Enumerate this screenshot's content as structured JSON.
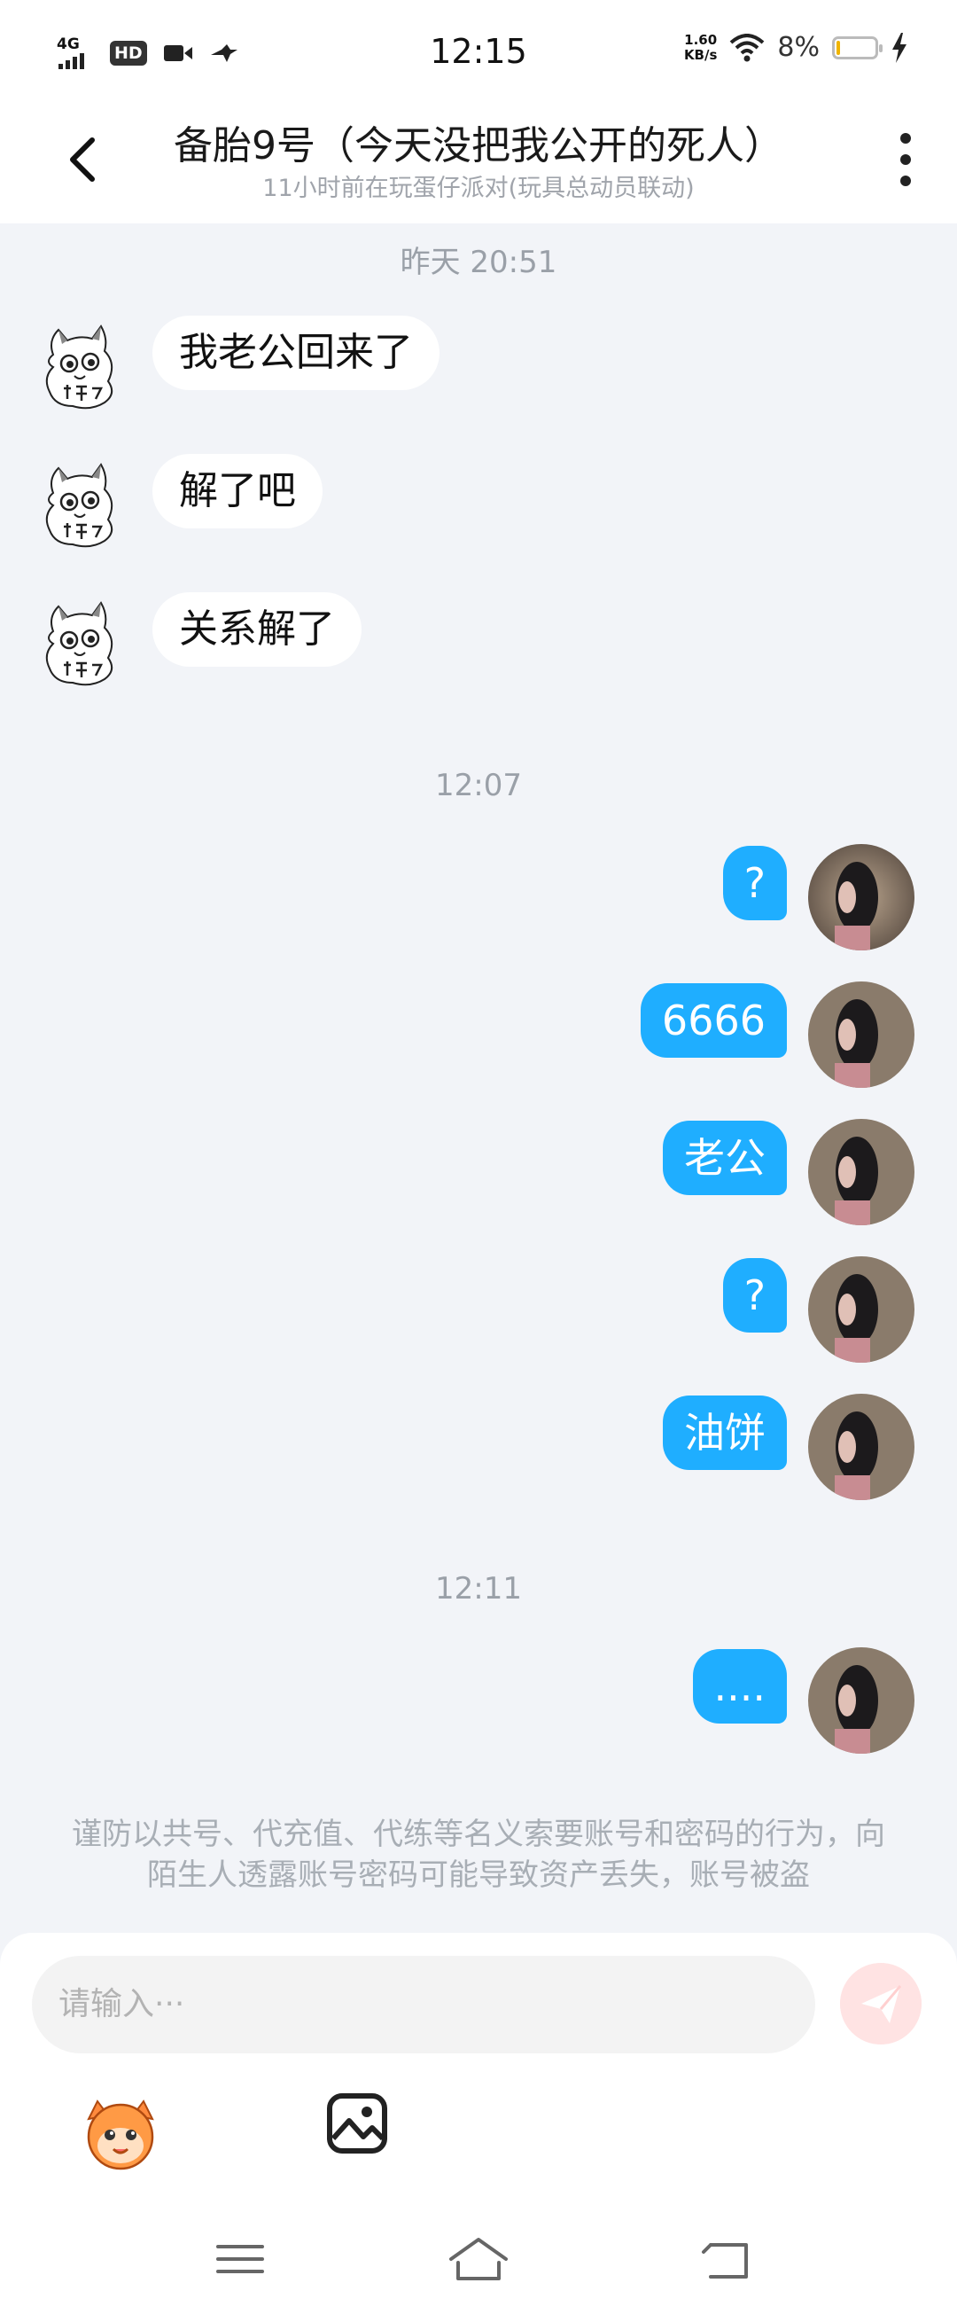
{
  "status_bar": {
    "network": "4G",
    "hd": "HD",
    "time": "12:15",
    "speed_value": "1.60",
    "speed_unit": "KB/s",
    "battery": "8%",
    "battery_level": 0.08
  },
  "header": {
    "title": "备胎9号（今天没把我公开的死人）",
    "subtitle": "11小时前在玩蛋仔派对(玩具总动员联动)"
  },
  "messages": {
    "ts1": "昨天 20:51",
    "in1": "我老公回来了",
    "in2": "解了吧",
    "in3": "关系解了",
    "ts2": "12:07",
    "out1": "?",
    "out2": "6666",
    "out3": "老公",
    "out4": "?",
    "out5": "油饼",
    "ts3": "12:11",
    "out6": "...."
  },
  "warning": "谨防以共号、代充值、代练等名义索要账号和密码的行为，向陌生人透露账号密码可能导致资产丢失，账号被盗",
  "input": {
    "placeholder": "请输入···"
  },
  "icons": [
    "back-arrow-icon",
    "more-vertical-icon",
    "send-icon",
    "emoji-icon",
    "image-icon",
    "menu-icon",
    "home-icon",
    "back-nav-icon"
  ],
  "colors": {
    "outgoing_bubble": "#1faeff",
    "incoming_bubble": "#ffffff",
    "background": "#f2f4f8",
    "send_button": "#ffe3e3"
  }
}
